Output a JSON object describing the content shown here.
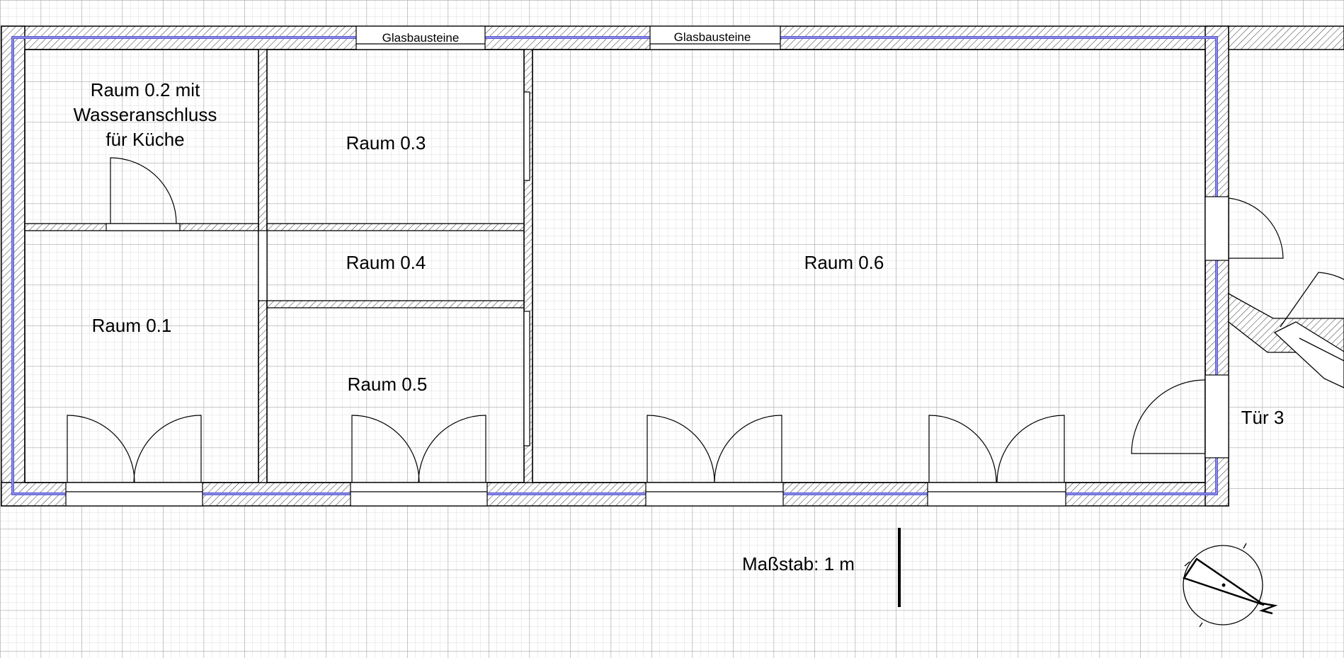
{
  "rooms": {
    "r01": "Raum 0.1",
    "r02": [
      "Raum 0.2 mit",
      "Wasseranschluss",
      "für Küche"
    ],
    "r03": "Raum 0.3",
    "r04": "Raum 0.4",
    "r05": "Raum 0.5",
    "r06": "Raum 0.6"
  },
  "windows": {
    "glass_left": "Glasbausteine",
    "glass_right": "Glasbausteine"
  },
  "door3": "Tür 3",
  "scale_label": "Maßstab: 1 m",
  "colors": {
    "wall_line": "#000000",
    "hatch": "#555555",
    "heating_line": "#5b5bd6",
    "grid_minor": "#dcdcdc",
    "grid_major": "#a8a8a8"
  },
  "icons": {
    "compass": "north-arrow-compass-icon"
  }
}
